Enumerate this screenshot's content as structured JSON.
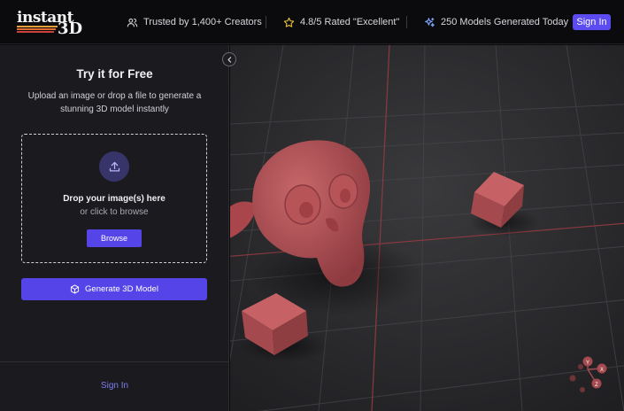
{
  "header": {
    "logo": {
      "line1": "instant",
      "line2": "3D"
    },
    "stats": [
      {
        "icon": "users-icon",
        "text": "Trusted by 1,400+ Creators"
      },
      {
        "icon": "star-icon",
        "text": "4.8/5 Rated \"Excellent\""
      },
      {
        "icon": "sparkles-icon",
        "text": "250 Models Generated Today"
      }
    ],
    "sign_in": "Sign In"
  },
  "panel": {
    "title": "Try it for Free",
    "description": "Upload an image or drop a file to generate a stunning 3D model instantly",
    "dropzone": {
      "title": "Drop your image(s) here",
      "subtitle": "or click to browse",
      "browse_label": "Browse"
    },
    "generate_label": "Generate 3D Model",
    "sign_in": "Sign In"
  },
  "gizmo": {
    "x": "X",
    "y": "Y",
    "z": "Z"
  },
  "colors": {
    "accent": "#5544e8",
    "model": "#b04e52",
    "grid_axis": "#8a3a40"
  }
}
